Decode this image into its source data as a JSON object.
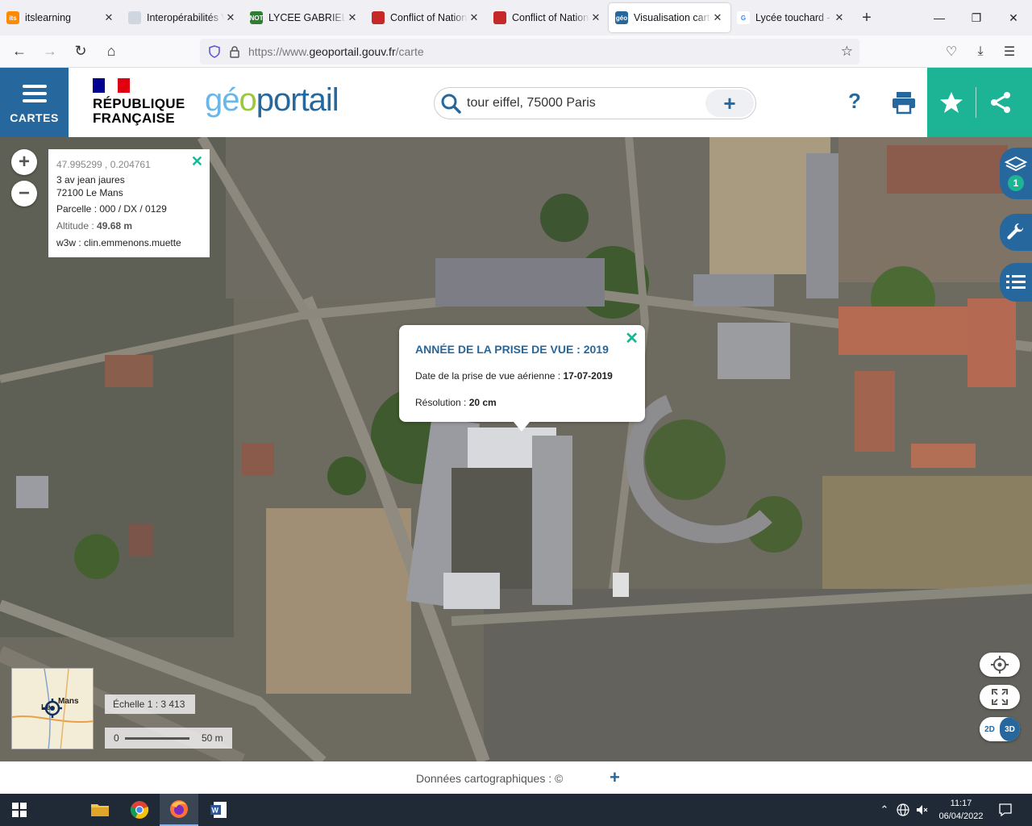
{
  "browser": {
    "tabs": [
      {
        "title": "itslearning",
        "icon": "itslearning-icon",
        "color": "#ff8a00",
        "badge": "its"
      },
      {
        "title": "Interopérabilités V",
        "icon": "page-icon",
        "color": "#cfd6e0",
        "badge": ""
      },
      {
        "title": "LYCEE GABRIEL TO",
        "icon": "lycee-icon",
        "color": "#2e7d32",
        "badge": "NOT"
      },
      {
        "title": "Conflict of Nation",
        "icon": "game-icon",
        "color": "#c62828",
        "badge": ""
      },
      {
        "title": "Conflict of Nation",
        "icon": "game-icon",
        "color": "#c62828",
        "badge": ""
      },
      {
        "title": "Visualisation carto",
        "icon": "geoportail-icon",
        "color": "#26689d",
        "badge": "géo",
        "active": true
      },
      {
        "title": "Lycée touchard - R",
        "icon": "google-icon",
        "color": "#ffffff",
        "badge": "G"
      }
    ],
    "url_prefix": "https://www.",
    "url_domain": "geoportail.gouv.fr",
    "url_path": "/carte"
  },
  "header": {
    "menu_label": "CARTES",
    "republique_line1": "RÉPUBLIQUE",
    "republique_line2": "FRANÇAISE",
    "logo_part1": "gé",
    "logo_part2": "o",
    "logo_part3": "portail",
    "search_value": "tour eiffel, 75000 Paris",
    "help": "?"
  },
  "info": {
    "coords": "47.995299 , 0.204761",
    "address_line1": "3 av jean jaures",
    "address_line2": "72100 Le Mans",
    "parcelle": "Parcelle : 000 / DX / 0129",
    "altitude_label": "Altitude : ",
    "altitude_value": "49.68 m",
    "w3w": "w3w : clin.emmenons.muette"
  },
  "popup": {
    "title": "ANNÉE DE LA PRISE DE VUE : 2019",
    "date_label": "Date de la prise de vue aérienne : ",
    "date_value": "17-07-2019",
    "res_label": "Résolution : ",
    "res_value": "20 cm"
  },
  "map": {
    "layers_count": "1",
    "overview_city": "Mans",
    "overview_city_prefix": "Le",
    "scale": "Échelle 1 : 3 413",
    "scalebar_start": "0",
    "scalebar_end": "50 m",
    "mode_2d": "2D",
    "mode_3d": "3D"
  },
  "footer": {
    "text": "Données cartographiques : ©",
    "plus": "+"
  },
  "taskbar": {
    "time": "11:17",
    "date": "06/04/2022"
  }
}
